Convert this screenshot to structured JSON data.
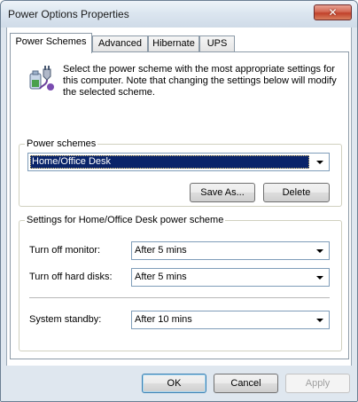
{
  "window": {
    "title": "Power Options Properties",
    "close_glyph": "✕"
  },
  "tabs": [
    {
      "label": "Power Schemes",
      "active": true
    },
    {
      "label": "Advanced",
      "active": false
    },
    {
      "label": "Hibernate",
      "active": false
    },
    {
      "label": "UPS",
      "active": false
    }
  ],
  "intro": {
    "icon": "power-plug-battery-icon",
    "text": "Select the power scheme with the most appropriate settings for this computer. Note that changing the settings below will modify the selected scheme."
  },
  "power_schemes": {
    "group_label": "Power schemes",
    "selected": "Home/Office Desk",
    "save_as_label": "Save As...",
    "delete_label": "Delete"
  },
  "settings": {
    "group_label": "Settings for Home/Office Desk power scheme",
    "monitor": {
      "label": "Turn off monitor:",
      "value": "After 5 mins"
    },
    "hard_disks": {
      "label": "Turn off hard disks:",
      "value": "After 5 mins"
    },
    "standby": {
      "label": "System standby:",
      "value": "After 10 mins"
    }
  },
  "footer": {
    "ok_label": "OK",
    "cancel_label": "Cancel",
    "apply_label": "Apply"
  },
  "colors": {
    "selection_bg": "#0a246a",
    "window_frame": "#dfe7ef"
  }
}
